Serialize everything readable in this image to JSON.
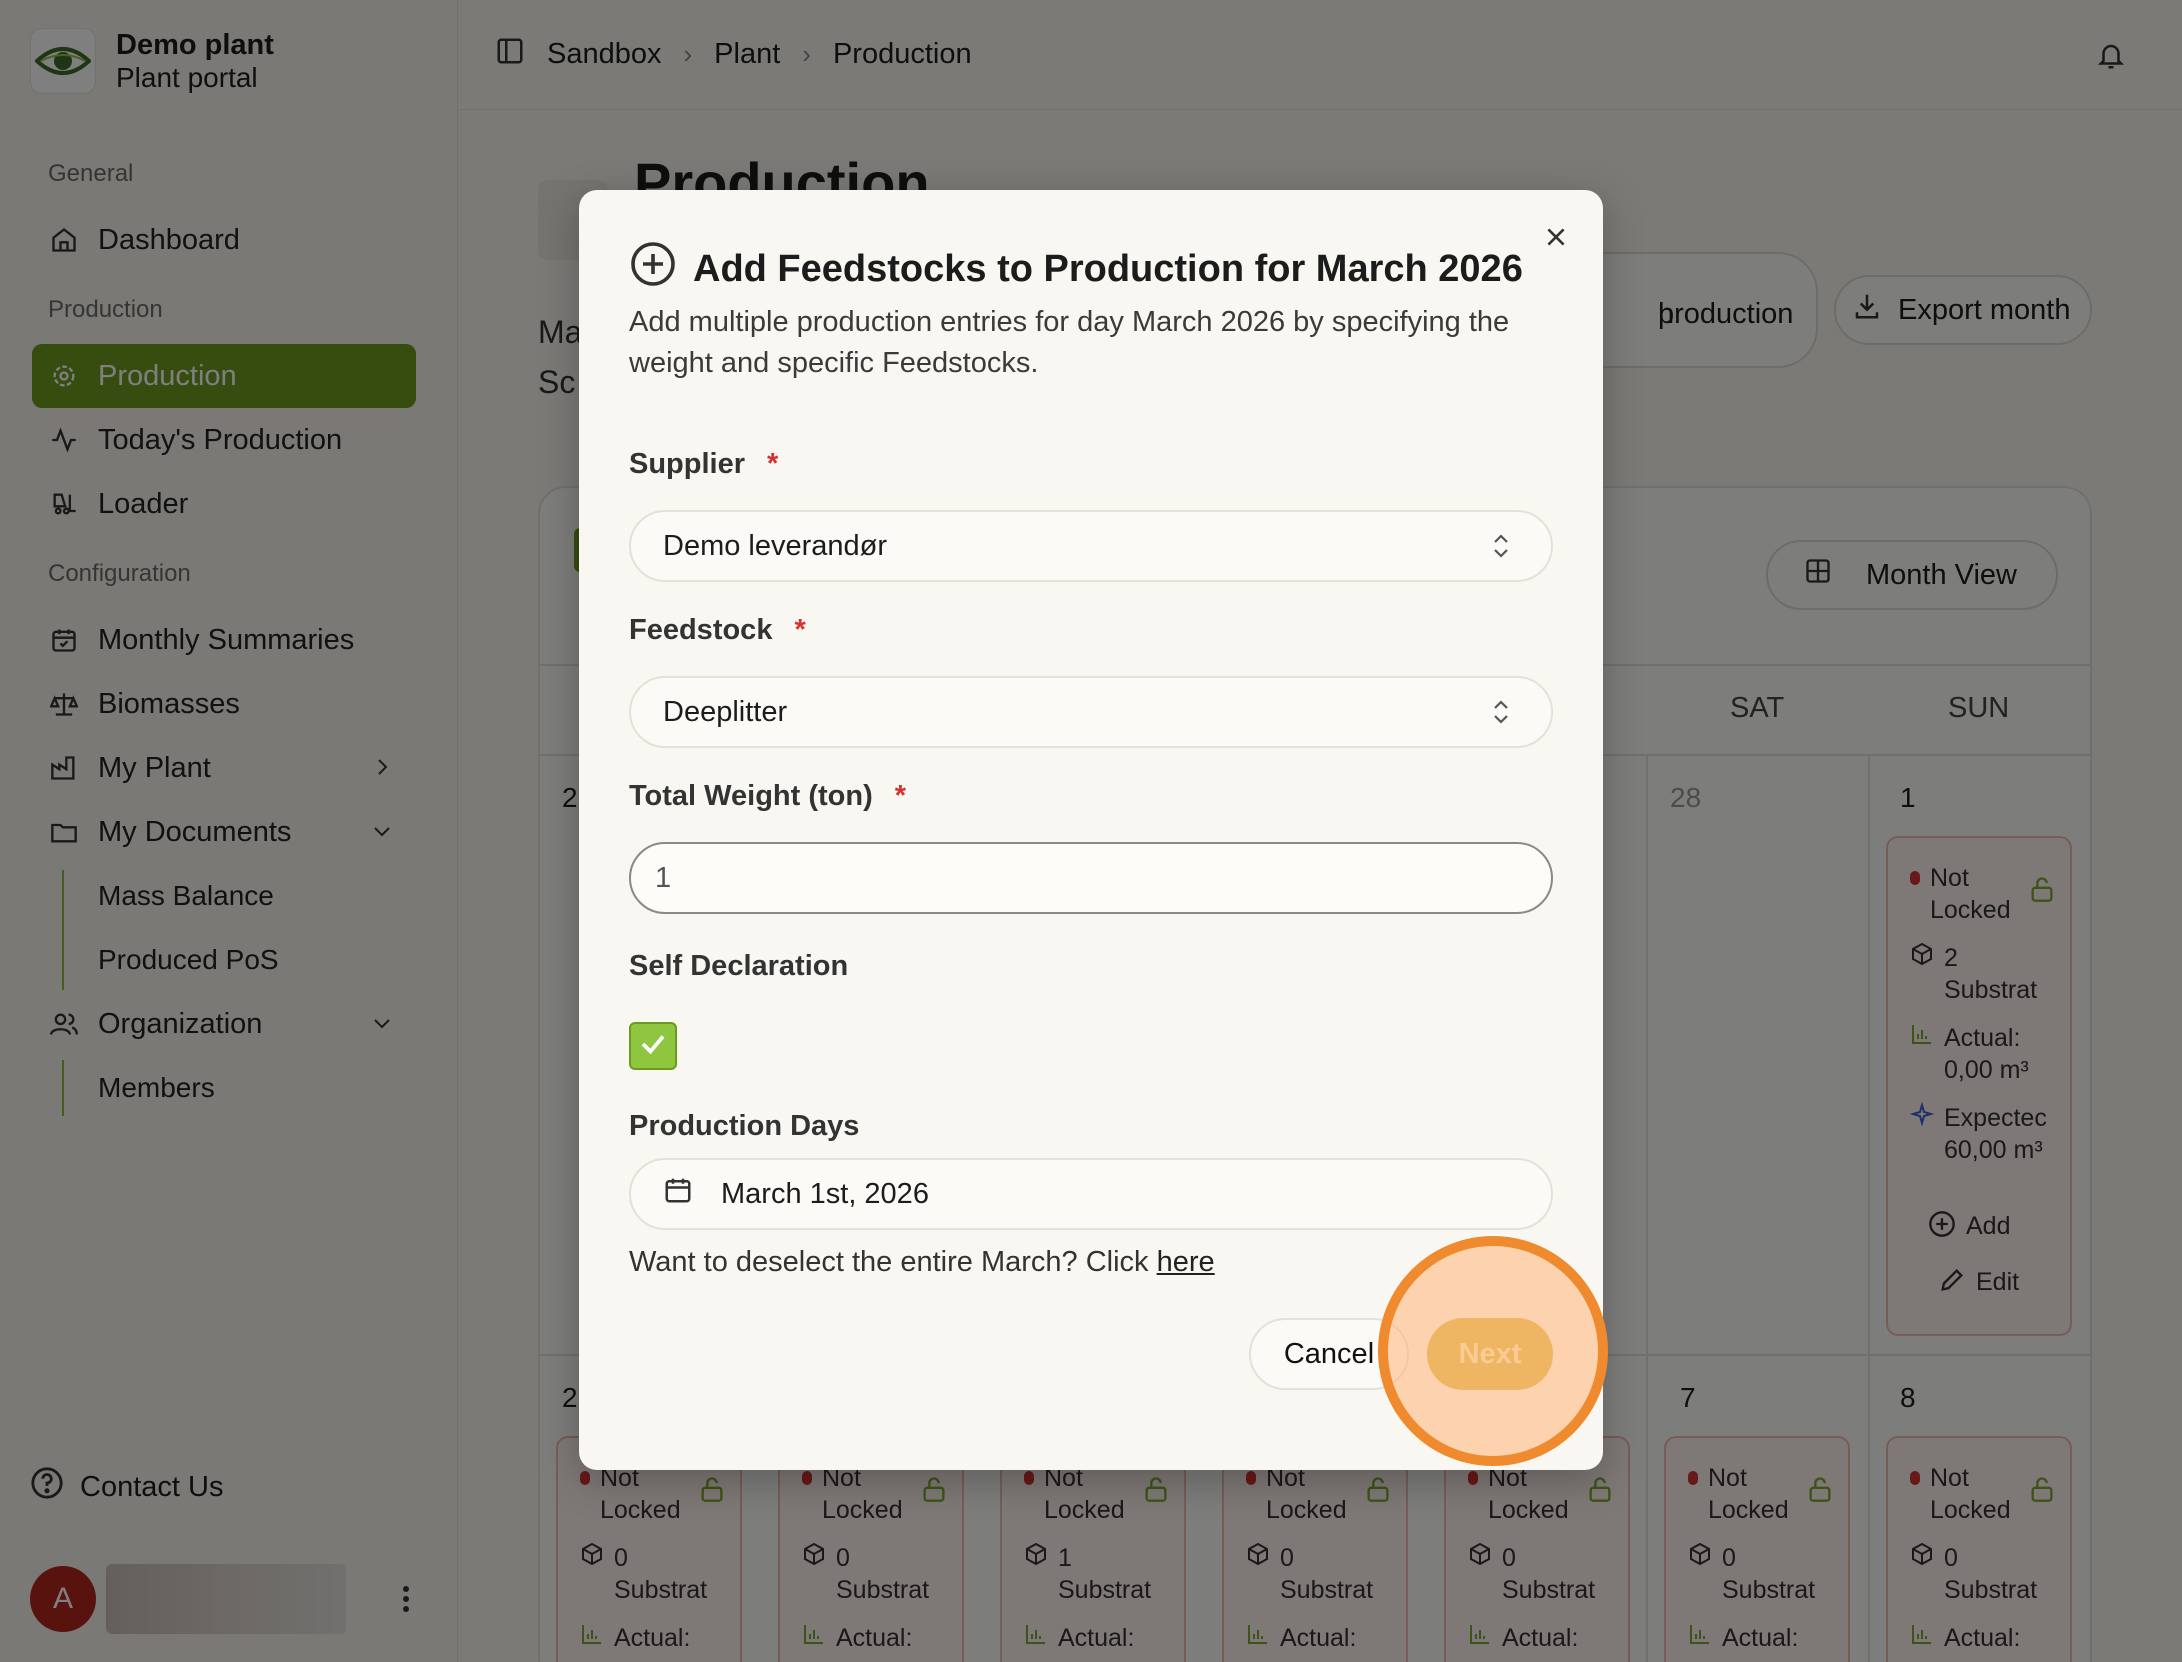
{
  "brand": {
    "name": "Demo plant",
    "subtitle": "Plant portal"
  },
  "sidebar": {
    "sections": {
      "general": "General",
      "production": "Production",
      "configuration": "Configuration"
    },
    "items": {
      "dashboard": "Dashboard",
      "production": "Production",
      "todays_production": "Today's Production",
      "loader": "Loader",
      "monthly_summaries": "Monthly Summaries",
      "biomasses": "Biomasses",
      "my_plant": "My Plant",
      "my_documents": "My Documents",
      "mass_balance": "Mass Balance",
      "produced_pos": "Produced PoS",
      "organization": "Organization",
      "members": "Members"
    },
    "contact": "Contact Us",
    "user_initial": "A"
  },
  "breadcrumb": [
    "Sandbox",
    "Plant",
    "Production"
  ],
  "page": {
    "title": "Production",
    "left_fragments": [
      "Ma",
      "Sc"
    ],
    "production_btn_fragment": "production",
    "production_btn_fragment2": "h",
    "export_month": "Export month",
    "month_view": "Month View"
  },
  "calendar": {
    "weekdays": {
      "sat": "SAT",
      "sun": "SUN"
    },
    "row1": {
      "left_frag": "2",
      "sat": "28",
      "sun": "1"
    },
    "row2": {
      "left_frag": "2",
      "sat": "7",
      "sun": "8"
    },
    "sun1_card": {
      "status": "Not Locked",
      "substrates_count": "2",
      "substrates_label": "Substrat",
      "actual_label": "Actual:",
      "actual_value": "0,00 m³",
      "expected_label": "Expectec",
      "expected_value": "60,00 m³",
      "add": "Add",
      "edit": "Edit"
    },
    "row2_cards": [
      {
        "status": "Not Locked",
        "count": "0",
        "substrates": "Substrat",
        "actual": "Actual:"
      },
      {
        "status": "Not Locked",
        "count": "0",
        "substrates": "Substrat",
        "actual": "Actual:"
      },
      {
        "status": "Not Locked",
        "count": "1",
        "substrates": "Substrat",
        "actual": "Actual:"
      },
      {
        "status": "Not Locked",
        "count": "0",
        "substrates": "Substrat",
        "actual": "Actual:"
      },
      {
        "status": "Not Locked",
        "count": "0",
        "substrates": "Substrat",
        "actual": "Actual:"
      },
      {
        "status": "Not Locked",
        "count": "0",
        "substrates": "Substrat",
        "actual": "Actual:"
      },
      {
        "status": "Not Locked",
        "count": "0",
        "substrates": "Substrat",
        "actual": "Actual:"
      }
    ]
  },
  "modal": {
    "title": "Add Feedstocks to Production for March 2026",
    "description": "Add multiple production entries for day March 2026 by specifying the weight and specific Feedstocks.",
    "supplier_label": "Supplier",
    "supplier_value": "Demo leverandør",
    "feedstock_label": "Feedstock",
    "feedstock_value": "Deeplitter",
    "weight_label": "Total Weight (ton)",
    "weight_value": "1",
    "required_mark": "*",
    "self_declaration_label": "Self Declaration",
    "self_declaration_checked": true,
    "production_days_label": "Production Days",
    "production_days_value": "March 1st, 2026",
    "deselect_text": "Want to deselect the entire March? Click",
    "deselect_link": "here",
    "cancel": "Cancel",
    "next": "Next"
  },
  "colors": {
    "accent": "#6d9a1f",
    "required": "#d33232",
    "next_button": "#d9b94a",
    "highlight": "#f08a2e"
  },
  "icons": [
    "eye-logo-icon",
    "home-icon",
    "gear-icon",
    "activity-icon",
    "forklift-icon",
    "calendar-check-icon",
    "scale-icon",
    "factory-icon",
    "folder-icon",
    "users-icon",
    "help-circle-icon",
    "kebab-icon",
    "sidebar-toggle-icon",
    "chevron-right-icon",
    "bell-icon",
    "download-icon",
    "grid-icon",
    "plus-circle-icon",
    "close-icon",
    "chevron-updown-icon",
    "check-icon",
    "calendar-icon",
    "lock-open-icon",
    "box-icon",
    "bar-chart-icon",
    "sparkle-icon",
    "pencil-icon"
  ]
}
